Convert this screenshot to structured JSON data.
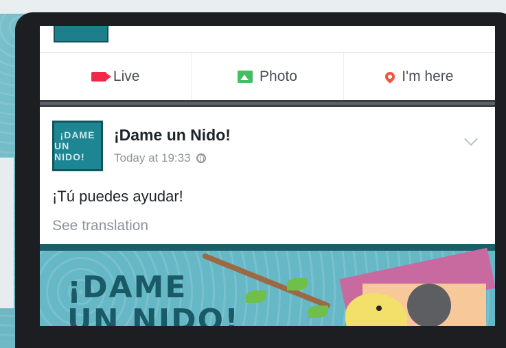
{
  "header": {
    "actions": [
      {
        "label": "Live",
        "icon": "video-camera-icon"
      },
      {
        "label": "Photo",
        "icon": "photo-icon"
      },
      {
        "label": "I'm here",
        "icon": "location-pin-icon"
      }
    ]
  },
  "post": {
    "page_name": "¡Dame un Nido!",
    "avatar_text_line1": "¡DAME",
    "avatar_text_line2": "UN NIDO!",
    "timestamp": "Today at 19:33",
    "text": "¡Tú puedes ayudar!",
    "see_translation": "See translation",
    "image_title_line1": "¡DAME",
    "image_title_line2": "UN NIDO!"
  },
  "colors": {
    "live": "#f02849",
    "photo": "#45bd62",
    "pin": "#f5533d",
    "brand_teal": "#1e8592"
  }
}
